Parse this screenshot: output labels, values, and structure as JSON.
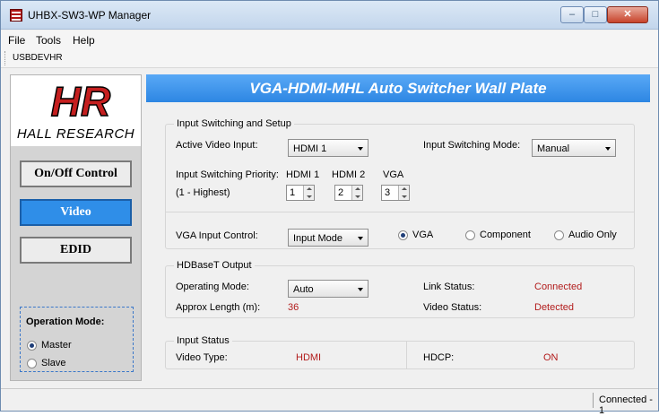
{
  "window": {
    "title": "UHBX-SW3-WP Manager",
    "min_glyph": "–",
    "max_glyph": "□",
    "close_glyph": "✕"
  },
  "menu": [
    "File",
    "Tools",
    "Help"
  ],
  "toolbar": {
    "device": "USBDEVHR"
  },
  "sidebar": {
    "logo_text": "HALL RESEARCH",
    "logo_mark": "HR",
    "nav": {
      "onoff": "On/Off Control",
      "video": "Video",
      "edid": "EDID"
    },
    "operation_mode": {
      "title": "Operation Mode:",
      "master": "Master",
      "slave": "Slave",
      "selected": "Master"
    }
  },
  "banner": "VGA-HDMI-MHL Auto Switcher Wall Plate",
  "input_setup": {
    "title": "Input Switching and Setup",
    "active_label": "Active Video Input:",
    "active_value": "HDMI 1",
    "mode_label": "Input Switching Mode:",
    "mode_value": "Manual",
    "priority_label": "Input Switching Priority:",
    "priority_sub": "(1 - Highest)",
    "priority_cols": [
      {
        "name": "HDMI 1",
        "value": "1"
      },
      {
        "name": "HDMI 2",
        "value": "2"
      },
      {
        "name": "VGA",
        "value": "3"
      }
    ],
    "vga_label": "VGA Input Control:",
    "vga_select": "Input Mode",
    "vga_options": [
      "VGA",
      "Component",
      "Audio Only"
    ],
    "vga_selected": "VGA"
  },
  "hdbaset": {
    "title": "HDBaseT Output",
    "mode_label": "Operating Mode:",
    "mode_value": "Auto",
    "length_label": "Approx Length (m):",
    "length_value": "36",
    "link_label": "Link Status:",
    "link_value": "Connected",
    "video_label": "Video Status:",
    "video_value": "Detected"
  },
  "input_status": {
    "title": "Input Status",
    "type_label": "Video Type:",
    "type_value": "HDMI",
    "hdcp_label": "HDCP:",
    "hdcp_value": "ON"
  },
  "statusbar": "Connected - 1",
  "colors": {
    "accent": "#2f8ee8",
    "value_red": "#b21c1c"
  }
}
